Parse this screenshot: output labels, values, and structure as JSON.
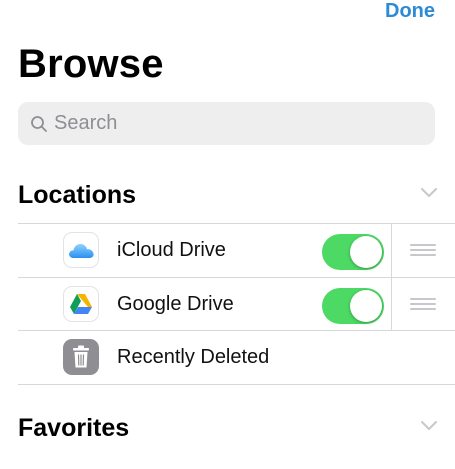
{
  "header": {
    "done_label": "Done",
    "title": "Browse"
  },
  "search": {
    "placeholder": "Search",
    "icon": "search-icon"
  },
  "sections": {
    "locations": {
      "title": "Locations",
      "chevron_icon": "chevron-down-icon",
      "items": [
        {
          "label": "iCloud Drive",
          "icon": "icloud-icon",
          "enabled": true
        },
        {
          "label": "Google Drive",
          "icon": "google-drive-icon",
          "enabled": true
        },
        {
          "label": "Recently Deleted",
          "icon": "trash-icon"
        }
      ]
    },
    "favorites": {
      "title": "Favorites",
      "chevron_icon": "chevron-down-icon"
    }
  },
  "colors": {
    "accent": "#2b8bd6",
    "toggle_on": "#4cd964",
    "search_bg": "#eeeeef",
    "separator": "#d8d8dc"
  }
}
